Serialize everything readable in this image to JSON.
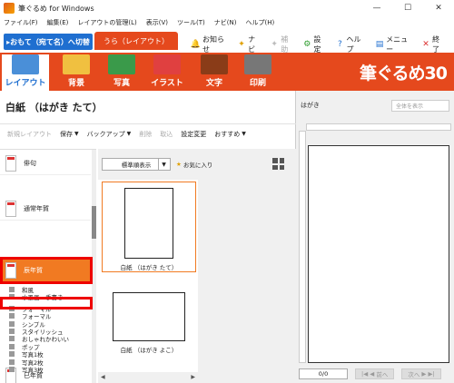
{
  "window": {
    "title": "筆ぐるめ for Windows",
    "minimize_glyph": "—",
    "maximize_glyph": "☐",
    "close_glyph": "✕"
  },
  "menu": [
    "ファイル(F)",
    "編集(E)",
    "レイアウトの管理(L)",
    "表示(V)",
    "ツール(T)",
    "ナビ(N)",
    "ヘルプ(H)"
  ],
  "tabs": {
    "omote": "▸おもて（宛て名）へ切替",
    "ura": "うら（レイアウト）"
  },
  "toplinks": [
    {
      "icon": "bell-icon",
      "glyph": "🔔",
      "label": "お知らせ",
      "color": "#e5491d",
      "disabled": false
    },
    {
      "icon": "navi-icon",
      "glyph": "✦",
      "label": "ナビ",
      "color": "#e0a000",
      "disabled": false
    },
    {
      "icon": "assist-icon",
      "glyph": "✦",
      "label": "補助",
      "color": "#bbb",
      "disabled": true
    },
    {
      "icon": "gear-icon",
      "glyph": "⚙",
      "label": "設定",
      "color": "#2a9a2a",
      "disabled": false
    },
    {
      "icon": "help-icon",
      "glyph": "?",
      "label": "ヘルプ",
      "color": "#1f6fd0",
      "disabled": false
    },
    {
      "icon": "menu-icon",
      "glyph": "▤",
      "label": "メニュー",
      "color": "#1f6fd0",
      "disabled": false
    },
    {
      "icon": "exit-icon",
      "glyph": "✕",
      "label": "終了",
      "color": "#d33",
      "disabled": false
    }
  ],
  "ribbon": {
    "items": [
      {
        "label": "レイアウト",
        "icon": "layout-icon",
        "active": true
      },
      {
        "label": "背景",
        "icon": "background-icon",
        "active": false
      },
      {
        "label": "写真",
        "icon": "photo-icon",
        "active": false
      },
      {
        "label": "イラスト",
        "icon": "illustration-icon",
        "active": false
      },
      {
        "label": "文字",
        "icon": "text-icon",
        "active": false
      },
      {
        "label": "印刷",
        "icon": "printer-icon",
        "active": false
      }
    ],
    "brand": "筆ぐるめ30",
    "accent": "#e5491d"
  },
  "doc_title": "白紙 （はがき たて）",
  "toolbar": [
    {
      "label": "新規レイアウト",
      "disabled": true,
      "caret": false
    },
    {
      "label": "保存",
      "disabled": false,
      "caret": true
    },
    {
      "label": "バックアップ",
      "disabled": false,
      "caret": true
    },
    {
      "label": "削除",
      "disabled": true,
      "caret": false
    },
    {
      "label": "取込",
      "disabled": true,
      "caret": false
    },
    {
      "label": "設定変更",
      "disabled": false,
      "caret": false
    },
    {
      "label": "おすすめ",
      "disabled": false,
      "caret": true
    }
  ],
  "categories": {
    "big": [
      {
        "label": "俳句",
        "selected": false
      },
      {
        "label": "通常年賀",
        "selected": false
      },
      {
        "label": "辰年賀",
        "selected": true
      },
      {
        "label": "巳年賀",
        "selected": false
      }
    ],
    "sub": [
      "和風",
      "水墨画・手書き",
      "フォーマル",
      "フォーマル",
      "シンプル",
      "スタイリッシュ",
      "おしゃれかわいい",
      "ポップ",
      "写真1枚",
      "写真2枚",
      "写真3枚"
    ]
  },
  "thumbpane": {
    "sort": "標準順表示",
    "favorite": "お気に入り",
    "items": [
      {
        "label": "白紙 （はがき たて）",
        "selected": true
      },
      {
        "label": "白紙 （はがき よこ）",
        "selected": false
      }
    ]
  },
  "preview": {
    "title": "はがき",
    "zoom": "全体を表示",
    "page": "0/0",
    "prev": "前へ",
    "next": "次へ"
  }
}
